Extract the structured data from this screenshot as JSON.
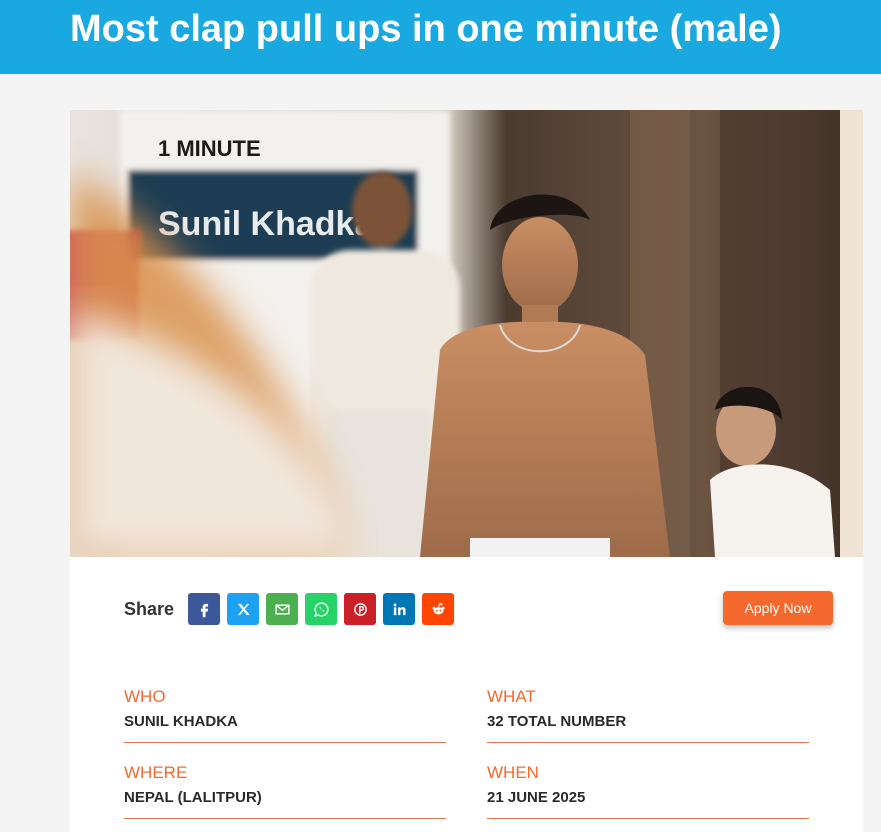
{
  "page": {
    "title": "Most clap pull ups in one minute (male)"
  },
  "photo": {
    "banner_line1": "1 MINUTE",
    "banner_name": "Sunil Khadka",
    "alt": "record holder photo"
  },
  "share": {
    "label": "Share",
    "buttons": [
      {
        "network": "facebook",
        "icon": "facebook-icon",
        "color": "#3b5998"
      },
      {
        "network": "x",
        "icon": "x-icon",
        "color": "#1da1f2"
      },
      {
        "network": "email",
        "icon": "email-icon",
        "color": "#4caf50"
      },
      {
        "network": "whatsapp",
        "icon": "whatsapp-icon",
        "color": "#25d366"
      },
      {
        "network": "pinterest",
        "icon": "pinterest-icon",
        "color": "#cb2027"
      },
      {
        "network": "linkedin",
        "icon": "linkedin-icon",
        "color": "#0077b5"
      },
      {
        "network": "reddit",
        "icon": "reddit-icon",
        "color": "#ff4500"
      }
    ]
  },
  "apply": {
    "label": "Apply Now",
    "color": "#f5692e"
  },
  "details": {
    "who": {
      "label": "WHO",
      "value": "SUNIL KHADKA"
    },
    "what": {
      "label": "WHAT",
      "value": "32 TOTAL NUMBER"
    },
    "where": {
      "label": "WHERE",
      "value": "NEPAL (LALITPUR)"
    },
    "when": {
      "label": "WHEN",
      "value": "21 JUNE 2025"
    }
  },
  "colors": {
    "header": "#19a8e0",
    "accent": "#f5692e"
  }
}
